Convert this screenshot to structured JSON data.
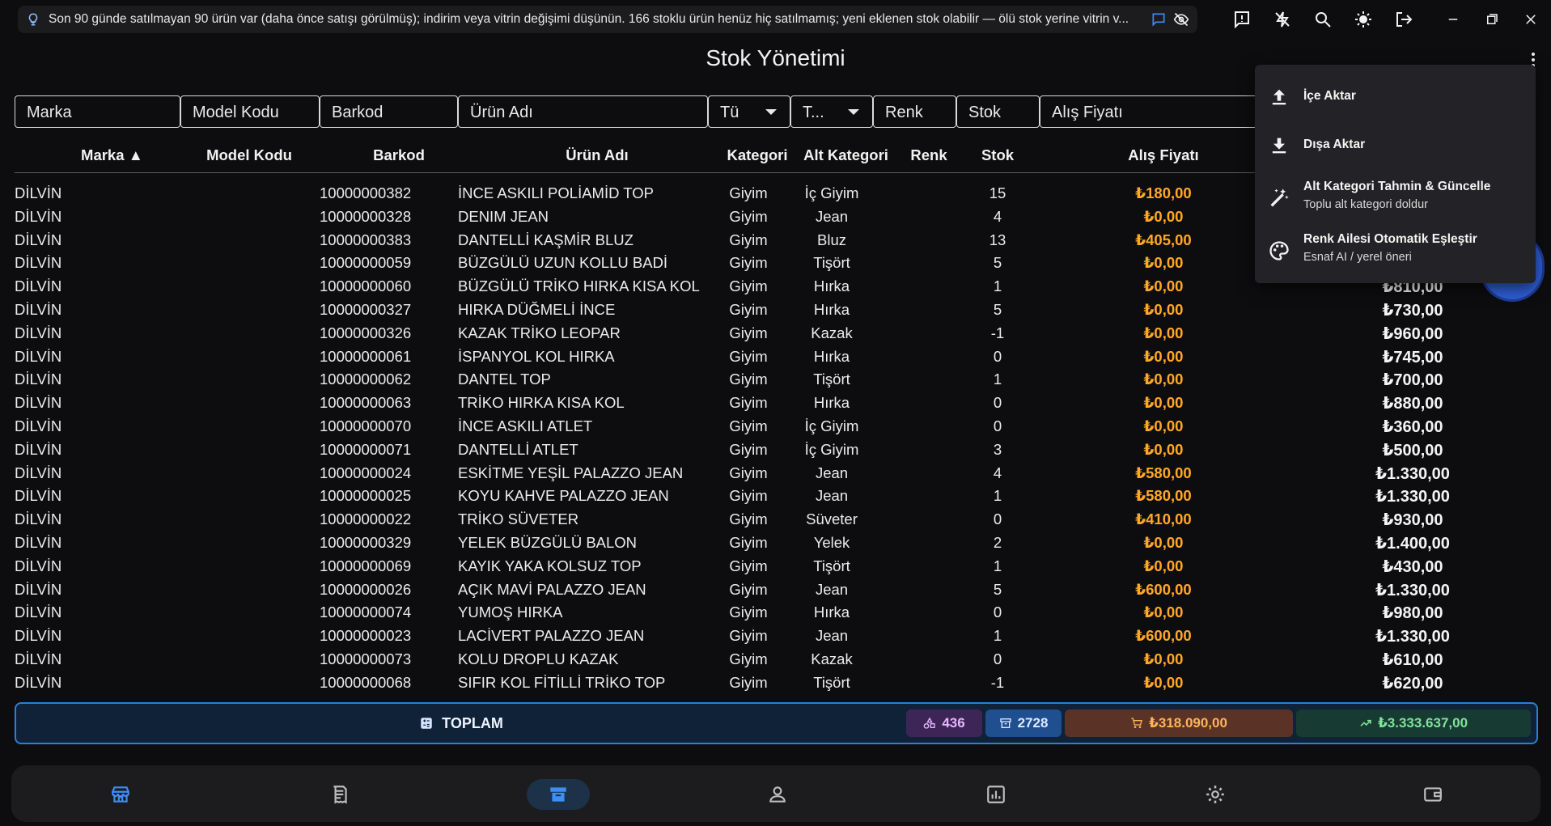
{
  "tip_bar": {
    "text": "Son 90 günde satılmayan 90 ürün var (daha önce satışı görülmüş); indirim veya vitrin değişimi düşünün. 166 stoklu ürün henüz hiç satılmamış; yeni eklenen stok olabilir — ölü stok yerine vitrin v..."
  },
  "page": {
    "title": "Stok Yönetimi"
  },
  "filters": {
    "marka": "Marka",
    "model_kodu": "Model Kodu",
    "barkod": "Barkod",
    "urun_adi": "Ürün Adı",
    "kategori": "Tü",
    "alt_kategori": "T...",
    "renk": "Renk",
    "stok": "Stok",
    "alis_fiyati": "Alış Fiyatı"
  },
  "table": {
    "headers": {
      "marka": "Marka ▲",
      "model_kodu": "Model Kodu",
      "barkod": "Barkod",
      "urun_adi": "Ürün Adı",
      "kategori": "Kategori",
      "alt_kategori": "Alt Kategori",
      "renk": "Renk",
      "stok": "Stok",
      "alis_fiyati": "Alış Fiyatı"
    },
    "rows": [
      {
        "marka": "DİLVİN",
        "barkod": "10000000382",
        "urun": "İNCE ASKILI POLİAMİD TOP",
        "kategori": "Giyim",
        "alt": "İç Giyim",
        "stok": "15",
        "alis": "₺180,00",
        "satis": ""
      },
      {
        "marka": "DİLVİN",
        "barkod": "10000000328",
        "urun": "DENIM JEAN",
        "kategori": "Giyim",
        "alt": "Jean",
        "stok": "4",
        "alis": "₺0,00",
        "satis": ""
      },
      {
        "marka": "DİLVİN",
        "barkod": "10000000383",
        "urun": "DANTELLİ KAŞMİR BLUZ",
        "kategori": "Giyim",
        "alt": "Bluz",
        "stok": "13",
        "alis": "₺405,00",
        "satis": ""
      },
      {
        "marka": "DİLVİN",
        "barkod": "10000000059",
        "urun": "BÜZGÜLÜ UZUN KOLLU BADİ",
        "kategori": "Giyim",
        "alt": "Tişört",
        "stok": "5",
        "alis": "₺0,00",
        "satis": ""
      },
      {
        "marka": "DİLVİN",
        "barkod": "10000000060",
        "urun": "BÜZGÜLÜ TRİKO HIRKA KISA KOL",
        "kategori": "Giyim",
        "alt": "Hırka",
        "stok": "1",
        "alis": "₺0,00",
        "satis": "₺810,00"
      },
      {
        "marka": "DİLVİN",
        "barkod": "10000000327",
        "urun": "HIRKA DÜĞMELİ İNCE",
        "kategori": "Giyim",
        "alt": "Hırka",
        "stok": "5",
        "alis": "₺0,00",
        "satis": "₺730,00"
      },
      {
        "marka": "DİLVİN",
        "barkod": "10000000326",
        "urun": "KAZAK TRİKO LEOPAR",
        "kategori": "Giyim",
        "alt": "Kazak",
        "stok": "-1",
        "alis": "₺0,00",
        "satis": "₺960,00"
      },
      {
        "marka": "DİLVİN",
        "barkod": "10000000061",
        "urun": "İSPANYOL KOL HIRKA",
        "kategori": "Giyim",
        "alt": "Hırka",
        "stok": "0",
        "alis": "₺0,00",
        "satis": "₺745,00"
      },
      {
        "marka": "DİLVİN",
        "barkod": "10000000062",
        "urun": "DANTEL TOP",
        "kategori": "Giyim",
        "alt": "Tişört",
        "stok": "1",
        "alis": "₺0,00",
        "satis": "₺700,00"
      },
      {
        "marka": "DİLVİN",
        "barkod": "10000000063",
        "urun": "TRİKO HIRKA KISA KOL",
        "kategori": "Giyim",
        "alt": "Hırka",
        "stok": "0",
        "alis": "₺0,00",
        "satis": "₺880,00"
      },
      {
        "marka": "DİLVİN",
        "barkod": "10000000070",
        "urun": "İNCE ASKILI ATLET",
        "kategori": "Giyim",
        "alt": "İç Giyim",
        "stok": "0",
        "alis": "₺0,00",
        "satis": "₺360,00"
      },
      {
        "marka": "DİLVİN",
        "barkod": "10000000071",
        "urun": "DANTELLİ ATLET",
        "kategori": "Giyim",
        "alt": "İç Giyim",
        "stok": "3",
        "alis": "₺0,00",
        "satis": "₺500,00"
      },
      {
        "marka": "DİLVİN",
        "barkod": "10000000024",
        "urun": "ESKİTME YEŞİL PALAZZO JEAN",
        "kategori": "Giyim",
        "alt": "Jean",
        "stok": "4",
        "alis": "₺580,00",
        "satis": "₺1.330,00"
      },
      {
        "marka": "DİLVİN",
        "barkod": "10000000025",
        "urun": "KOYU KAHVE PALAZZO JEAN",
        "kategori": "Giyim",
        "alt": "Jean",
        "stok": "1",
        "alis": "₺580,00",
        "satis": "₺1.330,00"
      },
      {
        "marka": "DİLVİN",
        "barkod": "10000000022",
        "urun": "TRİKO SÜVETER",
        "kategori": "Giyim",
        "alt": "Süveter",
        "stok": "0",
        "alis": "₺410,00",
        "satis": "₺930,00"
      },
      {
        "marka": "DİLVİN",
        "barkod": "10000000329",
        "urun": "YELEK BÜZGÜLÜ BALON",
        "kategori": "Giyim",
        "alt": "Yelek",
        "stok": "2",
        "alis": "₺0,00",
        "satis": "₺1.400,00"
      },
      {
        "marka": "DİLVİN",
        "barkod": "10000000069",
        "urun": "KAYIK YAKA KOLSUZ TOP",
        "kategori": "Giyim",
        "alt": "Tişört",
        "stok": "1",
        "alis": "₺0,00",
        "satis": "₺430,00"
      },
      {
        "marka": "DİLVİN",
        "barkod": "10000000026",
        "urun": "AÇIK MAVİ PALAZZO JEAN",
        "kategori": "Giyim",
        "alt": "Jean",
        "stok": "5",
        "alis": "₺600,00",
        "satis": "₺1.330,00"
      },
      {
        "marka": "DİLVİN",
        "barkod": "10000000074",
        "urun": "YUMOŞ HIRKA",
        "kategori": "Giyim",
        "alt": "Hırka",
        "stok": "0",
        "alis": "₺0,00",
        "satis": "₺980,00"
      },
      {
        "marka": "DİLVİN",
        "barkod": "10000000023",
        "urun": "LACİVERT PALAZZO JEAN",
        "kategori": "Giyim",
        "alt": "Jean",
        "stok": "1",
        "alis": "₺600,00",
        "satis": "₺1.330,00"
      },
      {
        "marka": "DİLVİN",
        "barkod": "10000000073",
        "urun": "KOLU DROPLU KAZAK",
        "kategori": "Giyim",
        "alt": "Kazak",
        "stok": "0",
        "alis": "₺0,00",
        "satis": "₺610,00"
      },
      {
        "marka": "DİLVİN",
        "barkod": "10000000068",
        "urun": "SIFIR KOL FİTİLLİ TRİKO TOP",
        "kategori": "Giyim",
        "alt": "Tişört",
        "stok": "-1",
        "alis": "₺0,00",
        "satis": "₺620,00"
      }
    ]
  },
  "totals": {
    "label": "TOPLAM",
    "product_count": "436",
    "stock_count": "2728",
    "purchase_total": "₺318.090,00",
    "sale_total": "₺3.333.637,00"
  },
  "menu": {
    "items": [
      {
        "title": "İçe Aktar",
        "icon": "upload-icon"
      },
      {
        "title": "Dışa Aktar",
        "icon": "download-icon"
      },
      {
        "title": "Alt Kategori Tahmin & Güncelle",
        "subtitle": "Toplu alt kategori doldur",
        "icon": "magic-wand-icon"
      },
      {
        "title": "Renk Ailesi Otomatik Eşleştir",
        "subtitle": "Esnaf AI / yerel öneri",
        "icon": "palette-icon"
      }
    ]
  },
  "bottom_nav": {
    "items": [
      {
        "icon": "store-icon",
        "active": false
      },
      {
        "icon": "receipt-icon",
        "active": false
      },
      {
        "icon": "archive-icon",
        "active": true
      },
      {
        "icon": "person-icon",
        "active": false
      },
      {
        "icon": "bar-chart-icon",
        "active": false
      },
      {
        "icon": "gear-icon",
        "active": false
      },
      {
        "icon": "wallet-icon",
        "active": false
      }
    ]
  },
  "colors": {
    "accent": "#2a7fd8",
    "purchase_price": "#ffa726",
    "chip_count_bg": "#3d2657",
    "chip_stock_bg": "#1f4f8f",
    "chip_purchase_bg": "#5a3326",
    "chip_sale_bg": "#173a32"
  }
}
